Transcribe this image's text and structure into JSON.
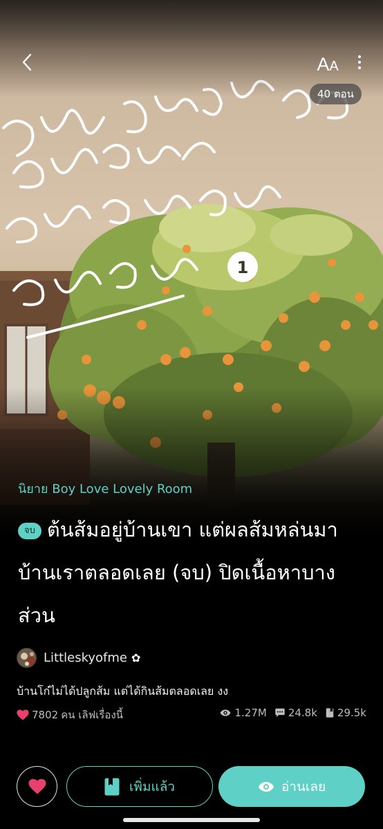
{
  "header": {
    "font_button_big": "A",
    "font_button_small": "A",
    "episode_count": "40 ตอน"
  },
  "story": {
    "category": "นิยาย Boy Love Lovely Room",
    "status_badge": "จบ",
    "title": "ต้นส้มอยู่บ้านเขา แต่ผลส้มหล่นมาบ้านเราตลอดเลย (จบ) ปิดเนื้อหาบางส่วน",
    "author": "Littleskyofme",
    "author_symbol": "✿",
    "synopsis": "บ้านโก๋ไม่ได้ปลูกส้ม แต่ได้กินส้มตลอดเลย งง"
  },
  "stats": {
    "likes_count": "7802",
    "likes_label": "คน เลิฟเรื่องนี้",
    "views": "1.27M",
    "comments": "24.8k",
    "bookmarks": "29.5k"
  },
  "actions": {
    "added_label": "เพิ่มแล้ว",
    "read_label": "อ่านเลย"
  },
  "colors": {
    "accent": "#5fd0c5",
    "heart": "#e8416f",
    "background": "#000000"
  },
  "icons": [
    "back-arrow-icon",
    "font-size-icon",
    "more-vertical-icon",
    "heart-icon",
    "eye-icon",
    "comment-icon",
    "bookmark-icon",
    "book-icon"
  ]
}
